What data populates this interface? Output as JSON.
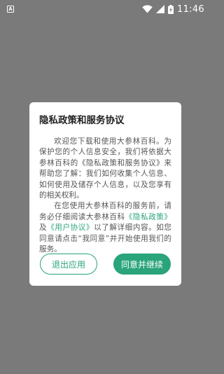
{
  "status_bar": {
    "time": "11:46",
    "left_icon": "a-notification-icon",
    "icons": [
      "wifi-icon",
      "signal-icon",
      "battery-charging-icon"
    ]
  },
  "dialog": {
    "title": "隐私政策和服务协议",
    "paragraph1": "欢迎您下载和使用大参林百科。为保护您的个人信息安全，我们将依据大参林百科的《隐私政策和服务协议》来帮助您了解：我们如何收集个人信息、如何使用及储存个人信息，以及您享有的相关权利。",
    "paragraph2_before": "在您使用大参林百科的服务前，请务必仔细阅读大参林百科",
    "privacy_link": "《隐私政策》",
    "paragraph2_and": "及",
    "user_link": "《用户协议》",
    "paragraph2_after": "以了解详细内容。如您同意请点击“我同意”并开始使用我们的服务。",
    "exit_button": "退出应用",
    "agree_button": "同意并继续"
  },
  "colors": {
    "accent": "#2aa47a",
    "overlay": "#7a7a7a"
  }
}
